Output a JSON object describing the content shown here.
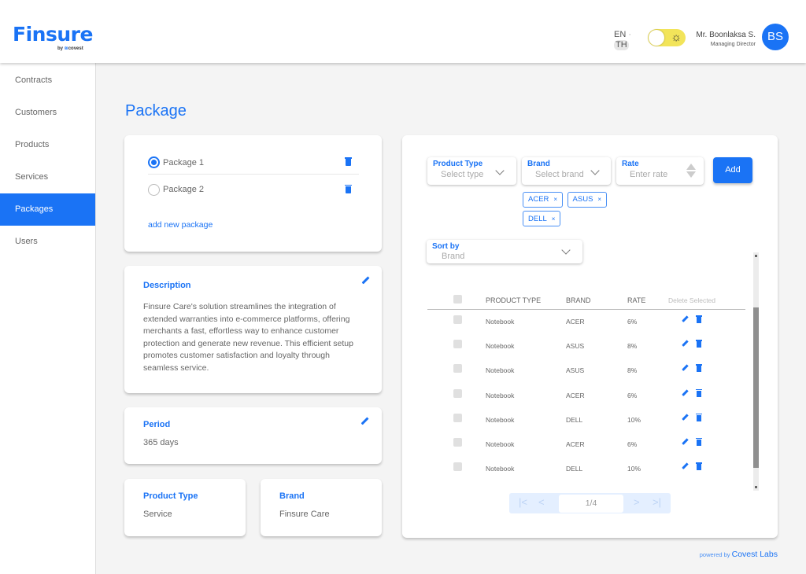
{
  "header": {
    "logo": "Finsure",
    "logo_sub_prefix": "by ",
    "logo_sub_brand": "covest",
    "lang_en": "EN",
    "lang_th": "TH",
    "theme_icon": "sun-icon",
    "user_name": "Mr. Boonlaksa S.",
    "user_role": "Managing Director",
    "avatar_initials": "BS"
  },
  "sidebar": {
    "items": [
      {
        "label": "Contracts",
        "active": false
      },
      {
        "label": "Customers",
        "active": false
      },
      {
        "label": "Products",
        "active": false
      },
      {
        "label": "Services",
        "active": false
      },
      {
        "label": "Packages",
        "active": true
      },
      {
        "label": "Users",
        "active": false
      }
    ]
  },
  "page": {
    "title": "Package"
  },
  "packages": {
    "items": [
      {
        "label": "Package 1",
        "selected": true
      },
      {
        "label": "Package 2",
        "selected": false
      }
    ],
    "add_label": "add new package"
  },
  "description": {
    "label": "Description",
    "text": "Finsure Care's solution streamlines the integration of extended warranties into e-commerce platforms, offering merchants a fast, effortless way to enhance customer protection and generate new revenue. This efficient setup promotes customer satisfaction and loyalty through seamless service."
  },
  "period": {
    "label": "Period",
    "value": "365 days"
  },
  "product_type_card": {
    "label": "Product Type",
    "value": "Service"
  },
  "brand_card": {
    "label": "Brand",
    "value": "Finsure Care"
  },
  "form": {
    "product_type_label": "Product Type",
    "product_type_placeholder": "Select type",
    "brand_label": "Brand",
    "brand_placeholder": "Select brand",
    "rate_label": "Rate",
    "rate_placeholder": "Enter rate",
    "add_label": "Add",
    "selected_brands": [
      "ACER",
      "ASUS",
      "DELL"
    ],
    "chip_remove": "×"
  },
  "sort": {
    "label": "Sort by",
    "value": "Brand"
  },
  "table": {
    "headers": {
      "product_type": "PRODUCT TYPE",
      "brand": "BRAND",
      "rate": "RATE",
      "delete_selected": "Delete Selected"
    },
    "rows": [
      {
        "product_type": "Notebook",
        "brand": "ACER",
        "rate": "6%"
      },
      {
        "product_type": "Notebook",
        "brand": "ASUS",
        "rate": "8%"
      },
      {
        "product_type": "Notebook",
        "brand": "ASUS",
        "rate": "8%"
      },
      {
        "product_type": "Notebook",
        "brand": "ACER",
        "rate": "6%"
      },
      {
        "product_type": "Notebook",
        "brand": "DELL",
        "rate": "10%"
      },
      {
        "product_type": "Notebook",
        "brand": "ACER",
        "rate": "6%"
      },
      {
        "product_type": "Notebook",
        "brand": "DELL",
        "rate": "10%"
      }
    ]
  },
  "pagination": {
    "current": 1,
    "total": 4,
    "display": "1/4",
    "first": "|<",
    "prev": "<",
    "next": ">",
    "last": ">|"
  },
  "footer": {
    "powered_prefix": "powered by ",
    "powered_brand": "Covest Labs"
  },
  "colors": {
    "primary": "#1a73f5",
    "toggle": "#f2e45a",
    "background": "#f4f4f4"
  }
}
